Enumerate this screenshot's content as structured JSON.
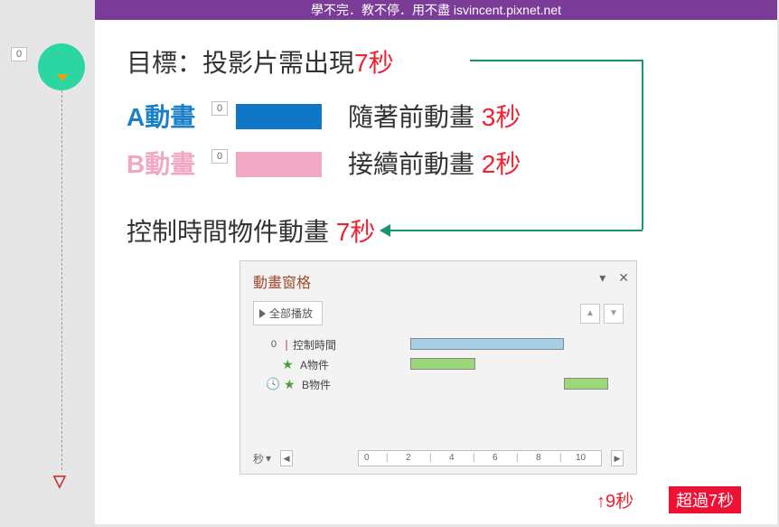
{
  "titlebar": "學不完．教不停．用不盡 isvincent.pixnet.net",
  "badges": {
    "b1": "0",
    "b2": "0",
    "b3": "0"
  },
  "goal": {
    "prefix": "目標：投影片需出現",
    "time": "7秒"
  },
  "anim_a": {
    "name": "A動畫",
    "desc": "隨著前動畫",
    "time": "3秒"
  },
  "anim_b": {
    "name": "B動畫",
    "desc": "接續前動畫",
    "time": "2秒"
  },
  "control": {
    "prefix": "控制時間物件動畫",
    "time": "7秒"
  },
  "pane": {
    "title": "動畫窗格",
    "play_all": "全部播放",
    "rows": {
      "r0": {
        "idx": "0",
        "label": "控制時間"
      },
      "r1": {
        "label": "A物件"
      },
      "r2": {
        "label": "B物件"
      }
    },
    "scale_label": "秒",
    "ticks": {
      "t0": "0",
      "t2": "2",
      "t4": "4",
      "t6": "6",
      "t8": "8",
      "t10": "10"
    }
  },
  "nine": "↑9秒",
  "over": "超過7秒",
  "end_marker": "⌄",
  "chart_data": {
    "type": "bar",
    "title": "動畫窗格 timeline",
    "xlabel": "秒",
    "xlim": [
      0,
      10
    ],
    "series": [
      {
        "name": "控制時間",
        "start": 0,
        "end": 7,
        "color": "#a7cfe8"
      },
      {
        "name": "A物件",
        "start": 0,
        "end": 3,
        "color": "#9cd77a"
      },
      {
        "name": "B物件",
        "start": 7,
        "end": 9,
        "color": "#9cd77a"
      }
    ]
  }
}
